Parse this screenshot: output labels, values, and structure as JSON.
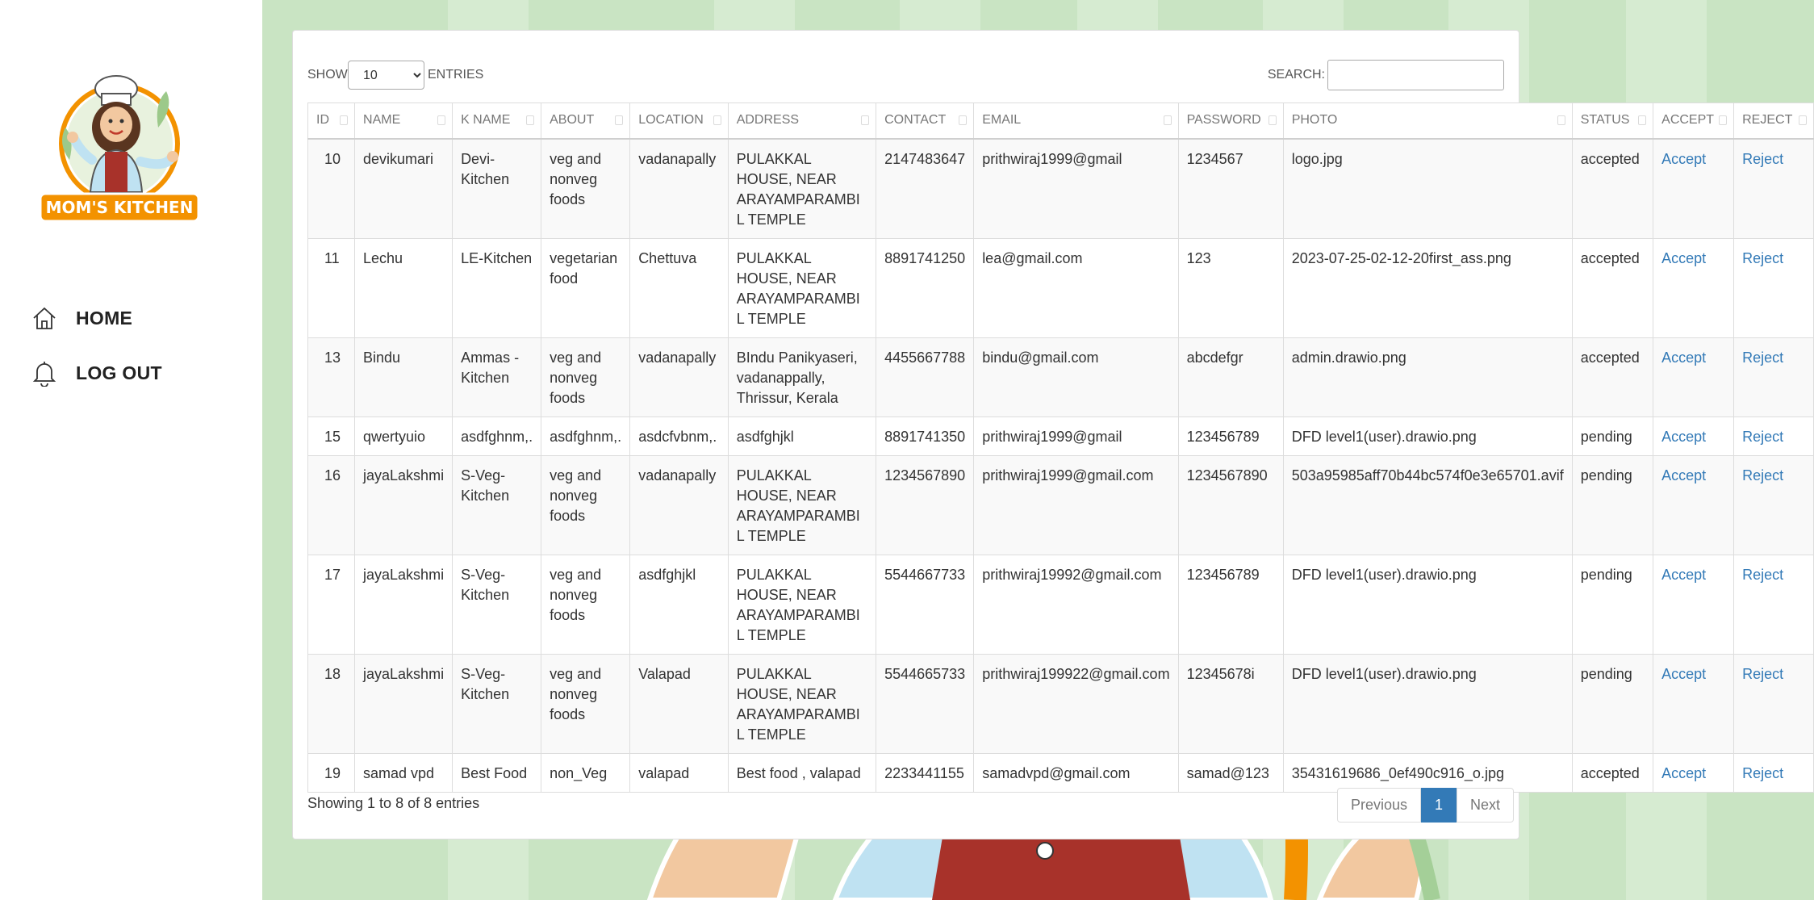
{
  "sidebar": {
    "brand": "MOM'S KITCHEN",
    "nav": [
      {
        "label": "HOME",
        "icon": "home-icon"
      },
      {
        "label": "LOG OUT",
        "icon": "bell-icon"
      }
    ]
  },
  "controls": {
    "show_label": "SHOW",
    "entries_value": "10",
    "entries_options": [
      "10"
    ],
    "entries_label": "ENTRIES",
    "search_label": "SEARCH:",
    "search_value": ""
  },
  "table": {
    "columns": [
      "ID",
      "NAME",
      "K NAME",
      "ABOUT",
      "LOCATION",
      "ADDRESS",
      "CONTACT",
      "EMAIL",
      "PASSWORD",
      "PHOTO",
      "STATUS",
      "ACCEPT",
      "REJECT"
    ],
    "rows": [
      {
        "id": "10",
        "name": "devikumari",
        "kname": "Devi-Kitchen",
        "about": "veg and nonveg foods",
        "location": "vadanapally",
        "address": "PULAKKAL HOUSE, NEAR ARAYAMPARAMBIL TEMPLE",
        "contact": "2147483647",
        "email": "prithwiraj1999@gmail",
        "password": "1234567",
        "photo": "logo.jpg",
        "status": "accepted",
        "accept": "Accept",
        "reject": "Reject"
      },
      {
        "id": "11",
        "name": "Lechu",
        "kname": "LE-Kitchen",
        "about": "vegetarian food",
        "location": "Chettuva",
        "address": "PULAKKAL HOUSE, NEAR ARAYAMPARAMBIL TEMPLE",
        "contact": "8891741250",
        "email": "lea@gmail.com",
        "password": "123",
        "photo": "2023-07-25-02-12-20first_ass.png",
        "status": "accepted",
        "accept": "Accept",
        "reject": "Reject"
      },
      {
        "id": "13",
        "name": "Bindu",
        "kname": "Ammas - Kitchen",
        "about": "veg and nonveg foods",
        "location": "vadanapally",
        "address": "BIndu Panikyaseri, vadanappally, Thrissur, Kerala",
        "contact": "4455667788",
        "email": "bindu@gmail.com",
        "password": "abcdefgr",
        "photo": "admin.drawio.png",
        "status": "accepted",
        "accept": "Accept",
        "reject": "Reject"
      },
      {
        "id": "15",
        "name": "qwertyuio",
        "kname": "asdfghnm,.",
        "about": "asdfghnm,.",
        "location": "asdcfvbnm,.",
        "address": "asdfghjkl",
        "contact": "8891741350",
        "email": "prithwiraj1999@gmail",
        "password": "123456789",
        "photo": "DFD level1(user).drawio.png",
        "status": "pending",
        "accept": "Accept",
        "reject": "Reject"
      },
      {
        "id": "16",
        "name": "jayaLakshmi",
        "kname": "S-Veg-Kitchen",
        "about": "veg and nonveg foods",
        "location": "vadanapally",
        "address": "PULAKKAL HOUSE, NEAR ARAYAMPARAMBIL TEMPLE",
        "contact": "1234567890",
        "email": "prithwiraj1999@gmail.com",
        "password": "1234567890",
        "photo": "503a95985aff70b44bc574f0e3e65701.avif",
        "status": "pending",
        "accept": "Accept",
        "reject": "Reject"
      },
      {
        "id": "17",
        "name": "jayaLakshmi",
        "kname": "S-Veg-Kitchen",
        "about": "veg and nonveg foods",
        "location": "asdfghjkl",
        "address": "PULAKKAL HOUSE, NEAR ARAYAMPARAMBIL TEMPLE",
        "contact": "5544667733",
        "email": "prithwiraj19992@gmail.com",
        "password": "123456789",
        "photo": "DFD level1(user).drawio.png",
        "status": "pending",
        "accept": "Accept",
        "reject": "Reject"
      },
      {
        "id": "18",
        "name": "jayaLakshmi",
        "kname": "S-Veg-Kitchen",
        "about": "veg and nonveg foods",
        "location": "Valapad",
        "address": "PULAKKAL HOUSE, NEAR ARAYAMPARAMBIL TEMPLE",
        "contact": "5544665733",
        "email": "prithwiraj199922@gmail.com",
        "password": "12345678i",
        "photo": "DFD level1(user).drawio.png",
        "status": "pending",
        "accept": "Accept",
        "reject": "Reject"
      },
      {
        "id": "19",
        "name": "samad vpd",
        "kname": "Best Food",
        "about": "non_Veg",
        "location": "valapad",
        "address": "Best food , valapad",
        "contact": "2233441155",
        "email": "samadvpd@gmail.com",
        "password": "samad@123",
        "photo": "35431619686_0ef490c916_o.jpg",
        "status": "accepted",
        "accept": "Accept",
        "reject": "Reject"
      }
    ]
  },
  "footer": {
    "info": "Showing 1 to 8 of 8 entries",
    "prev": "Previous",
    "page": "1",
    "next": "Next"
  },
  "colors": {
    "accent": "#337ab7",
    "background_green": "#c9e4c3",
    "brand_orange": "#f39200"
  }
}
